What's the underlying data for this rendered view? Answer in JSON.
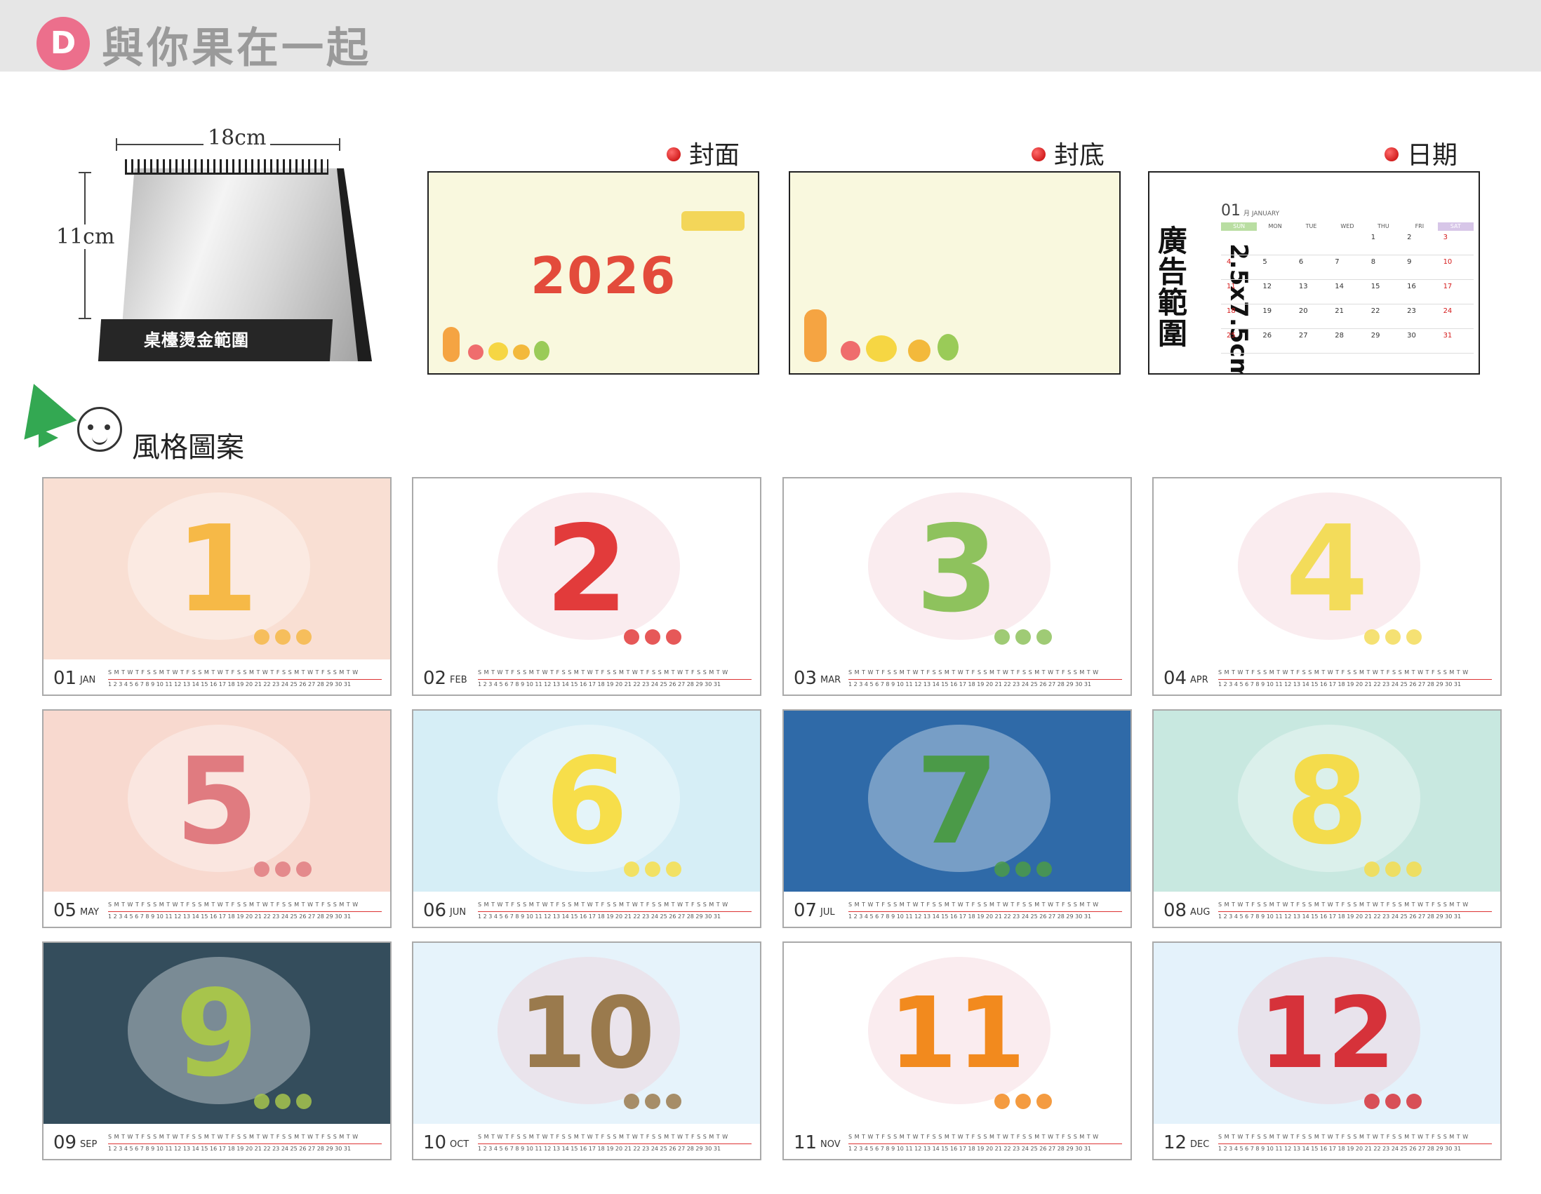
{
  "header": {
    "badge": "D",
    "title": "與你果在一起"
  },
  "desk": {
    "width_label": "18cm",
    "height_label": "11cm",
    "base_label": "桌檯燙金範圍"
  },
  "sections": {
    "cover": "封面",
    "back": "封底",
    "date": "日期",
    "style": "風格圖案"
  },
  "cover": {
    "year": "2026"
  },
  "date_panel": {
    "ad_label": "廣告範圍",
    "ad_size": "2.5x7.5cm",
    "month_num": "01",
    "month_name": "月 JANUARY",
    "weekdays": [
      "SUN",
      "MON",
      "TUE",
      "WED",
      "THU",
      "FRI",
      "SAT"
    ],
    "days": [
      "",
      "",
      "",
      "",
      "1",
      "2",
      "3",
      "4",
      "5",
      "6",
      "7",
      "8",
      "9",
      "10",
      "11",
      "12",
      "13",
      "14",
      "15",
      "16",
      "17",
      "18",
      "19",
      "20",
      "21",
      "22",
      "23",
      "24",
      "25",
      "26",
      "27",
      "28",
      "29",
      "30",
      "31"
    ]
  },
  "months": [
    {
      "num": "01",
      "abbr": "JAN",
      "big": "1",
      "bg": "#f9dfd3",
      "color": "#f6b947"
    },
    {
      "num": "02",
      "abbr": "FEB",
      "big": "2",
      "bg": "#ffffff",
      "color": "#e23b3b"
    },
    {
      "num": "03",
      "abbr": "MAR",
      "big": "3",
      "bg": "#ffffff",
      "color": "#8ec25d"
    },
    {
      "num": "04",
      "abbr": "APR",
      "big": "4",
      "bg": "#ffffff",
      "color": "#f3dc5a"
    },
    {
      "num": "05",
      "abbr": "MAY",
      "big": "5",
      "bg": "#f8d9cf",
      "color": "#e07b80"
    },
    {
      "num": "06",
      "abbr": "JUN",
      "big": "6",
      "bg": "#d6eef6",
      "color": "#f7de4a"
    },
    {
      "num": "07",
      "abbr": "JUL",
      "big": "7",
      "bg": "#2f6aa8",
      "color": "#4b9a48"
    },
    {
      "num": "08",
      "abbr": "AUG",
      "big": "8",
      "bg": "#c8e8e0",
      "color": "#f4dc4c"
    },
    {
      "num": "09",
      "abbr": "SEP",
      "big": "9",
      "bg": "#344d5c",
      "color": "#a7c44c"
    },
    {
      "num": "10",
      "abbr": "OCT",
      "big": "10",
      "bg": "#e6f3fb",
      "color": "#9a7a4d"
    },
    {
      "num": "11",
      "abbr": "NOV",
      "big": "11",
      "bg": "#ffffff",
      "color": "#f28a1e"
    },
    {
      "num": "12",
      "abbr": "DEC",
      "big": "12",
      "bg": "#e4f2fb",
      "color": "#d6323a"
    }
  ],
  "strip": {
    "days_row": "S M T W T F S S M T W T F S S M T W T F S S M T W T F S S M T W T F S S M T W",
    "nums_row": "1 2 3 4 5 6 7 8 9 10 11 12 13 14 15 16 17 18 19 20 21 22 23 24 25 26 27 28 29 30 31"
  }
}
